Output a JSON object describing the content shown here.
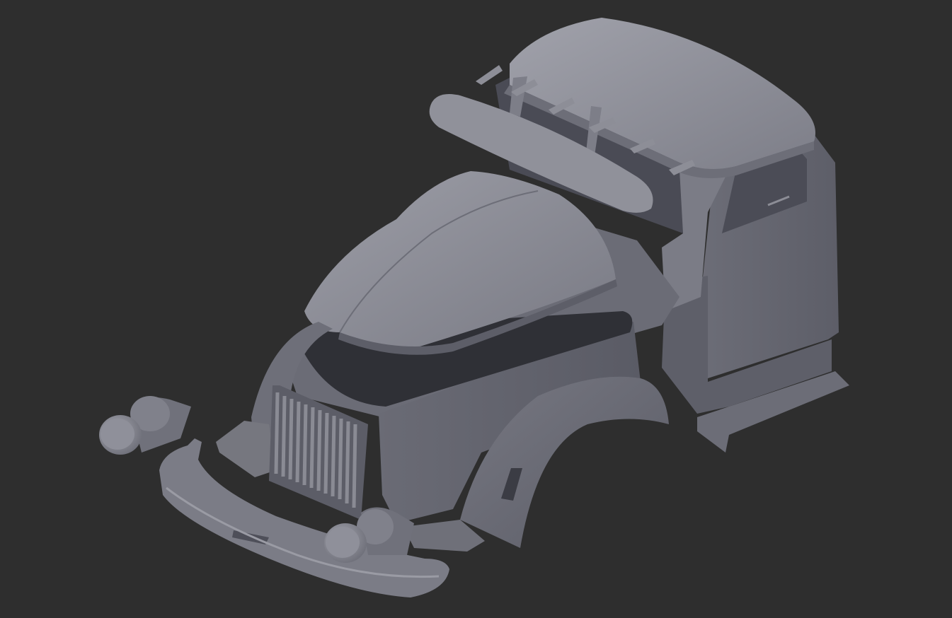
{
  "viewport": {
    "background_color": "#2e2e2e",
    "model_base_color": "#85868f",
    "model_light_color": "#a1a2ab",
    "model_shadow_color": "#4e4f59",
    "model_dark_color": "#383941"
  },
  "scene": {
    "subject": "truck-cab-3d-model",
    "parts": [
      "cab-roof-icon",
      "sun-visor-icon",
      "roof-marker-light-icon",
      "windshield-frame-icon",
      "cab-door-icon",
      "running-board-icon",
      "hood-icon",
      "cowl-icon",
      "front-fender-icon",
      "grille-icon",
      "left-fender-icon",
      "front-bumper-icon",
      "headlight-left-icon",
      "headlight-right-icon"
    ]
  }
}
